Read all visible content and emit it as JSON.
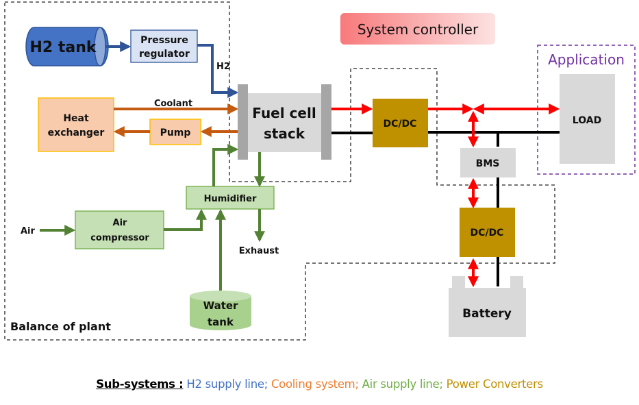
{
  "colors": {
    "h2": "#2f5597",
    "cooling": "#c55a11",
    "air": "#548235",
    "power": "#ff0000",
    "bus": "#000000",
    "converter": "#bf9000",
    "application": "#7030a0",
    "legend_h2": "#4472c4",
    "legend_cooling": "#ed7d31",
    "legend_air": "#70ad47",
    "legend_power": "#bf9000"
  },
  "components": {
    "h2_tank": "H2 tank",
    "pressure_regulator": [
      "Pressure",
      "regulator"
    ],
    "heat_exchanger": [
      "Heat",
      "exchanger"
    ],
    "pump": "Pump",
    "fuel_cell_stack": [
      "Fuel cell",
      "stack"
    ],
    "humidifier": "Humidifier",
    "air_compressor": [
      "Air",
      "compressor"
    ],
    "water_tank": [
      "Water",
      "tank"
    ],
    "dcdc_fc": "DC/DC",
    "dcdc_battery": "DC/DC",
    "bms": "BMS",
    "battery": "Battery",
    "load": "LOAD",
    "system_controller": "System controller"
  },
  "flow_labels": {
    "h2": "H2",
    "coolant": "Coolant",
    "air_in": "Air",
    "exhaust": "Exhaust"
  },
  "groups": {
    "balance_of_plant": "Balance of plant",
    "application": "Application"
  },
  "legend": {
    "heading": "Sub-systems :",
    "items": [
      "H2 supply line;",
      "Cooling system;",
      "Air supply line;",
      "Power Converters"
    ]
  }
}
